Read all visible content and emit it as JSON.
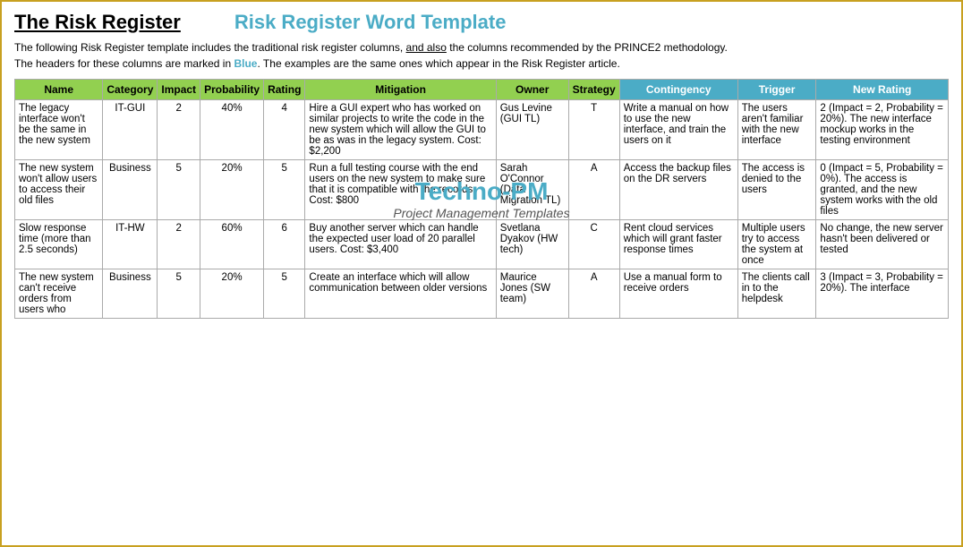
{
  "header": {
    "main_title": "The Risk Register",
    "sub_title": "Risk Register Word Template"
  },
  "description": {
    "line1": "The following Risk Register template includes the traditional risk register columns, and also the columns recommended by the PRINCE2 methodology.",
    "line1_underline": "and also",
    "line2": "The headers for these columns are marked in Blue. The examples are the same ones which appear in the Risk Register article.",
    "line2_blue": "Blue"
  },
  "watermark": {
    "title": "Techno-PM",
    "subtitle": "Project Management Templates"
  },
  "table": {
    "headers": [
      {
        "label": "Name",
        "blue": false
      },
      {
        "label": "Category",
        "blue": false
      },
      {
        "label": "Impact",
        "blue": false
      },
      {
        "label": "Probability",
        "blue": false
      },
      {
        "label": "Rating",
        "blue": false
      },
      {
        "label": "Mitigation",
        "blue": false
      },
      {
        "label": "Owner",
        "blue": false
      },
      {
        "label": "Strategy",
        "blue": false
      },
      {
        "label": "Contingency",
        "blue": true
      },
      {
        "label": "Trigger",
        "blue": true
      },
      {
        "label": "New Rating",
        "blue": true
      }
    ],
    "rows": [
      {
        "name": "The legacy interface won't be the same in the new system",
        "category": "IT-GUI",
        "impact": "2",
        "probability": "40%",
        "rating": "4",
        "mitigation": "Hire a GUI expert who has worked on similar projects to write the code in the new system which will allow the GUI to be as was in the legacy system. Cost: $2,200",
        "owner": "Gus Levine (GUI TL)",
        "strategy": "T",
        "contingency": "Write a manual on how to use the new interface, and train the users on it",
        "trigger": "The users aren't familiar with the new interface",
        "new_rating": "2 (Impact = 2, Probability = 20%). The new interface mockup works in the testing environment"
      },
      {
        "name": "The new system won't allow users to access their old files",
        "category": "Business",
        "impact": "5",
        "probability": "20%",
        "rating": "5",
        "mitigation": "Run a full testing course with the end users on the new system to make sure that it is compatible with the records. Cost: $800",
        "owner": "Sarah O'Connor (Data Migration TL)",
        "strategy": "A",
        "contingency": "Access the backup files on the DR servers",
        "trigger": "The access is denied to the users",
        "new_rating": "0 (Impact = 5, Probability = 0%). The access is granted, and the new system works with the old files"
      },
      {
        "name": "Slow response time (more than 2.5 seconds)",
        "category": "IT-HW",
        "impact": "2",
        "probability": "60%",
        "rating": "6",
        "mitigation": "Buy another server which can handle the expected user load of 20 parallel users. Cost: $3,400",
        "owner": "Svetlana Dyakov (HW tech)",
        "strategy": "C",
        "contingency": "Rent cloud services which will grant faster response times",
        "trigger": "Multiple users try to access the system at once",
        "new_rating": "No change, the new server hasn't been delivered or tested"
      },
      {
        "name": "The new system can't receive orders from users who",
        "category": "Business",
        "impact": "5",
        "probability": "20%",
        "rating": "5",
        "mitigation": "Create an interface which will allow communication between older versions",
        "owner": "Maurice Jones (SW team)",
        "strategy": "A",
        "contingency": "Use a manual form to receive orders",
        "trigger": "The clients call in to the helpdesk",
        "new_rating": "3 (Impact = 3, Probability = 20%). The interface"
      }
    ]
  }
}
